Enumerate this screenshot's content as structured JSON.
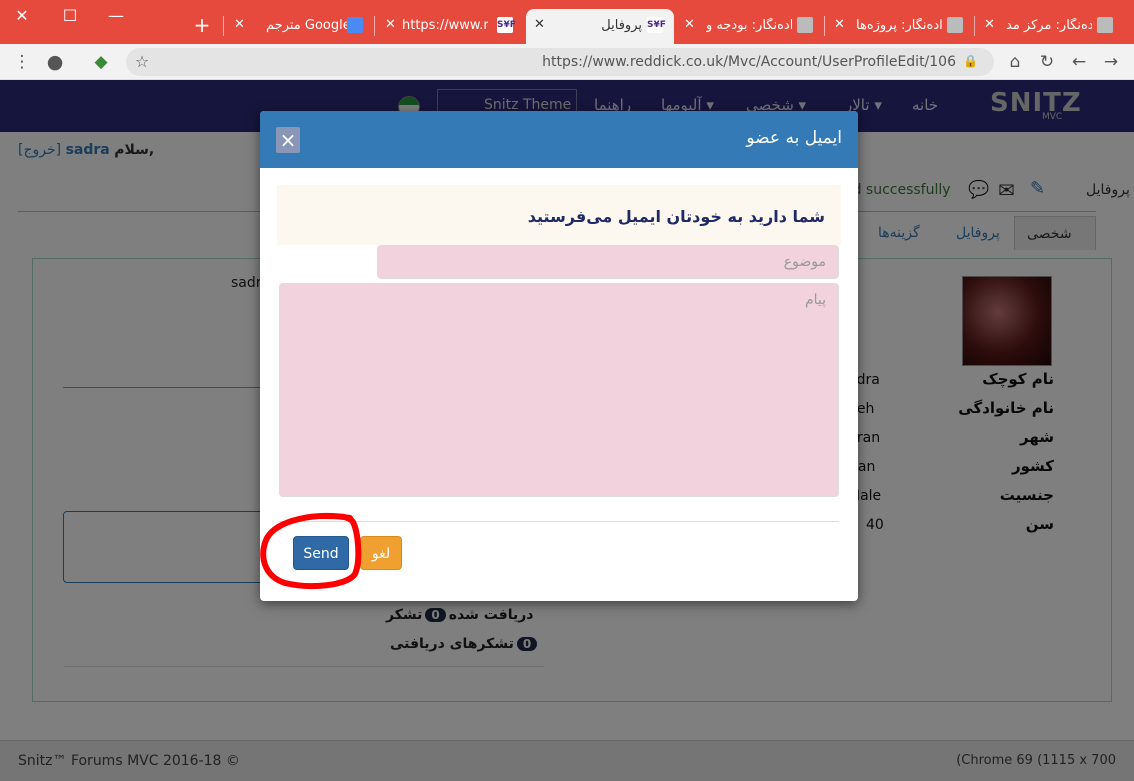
{
  "browser": {
    "window_controls": {
      "close": "✕",
      "maximize": "☐",
      "minimize": "—"
    },
    "new_tab": "+",
    "tabs": [
      {
        "label": "مترجم Google",
        "icon": "google-translate-icon"
      },
      {
        "label": "https://www.red",
        "icon": "snitz-icon"
      },
      {
        "label": "پروفایل",
        "icon": "snitz-icon",
        "active": true
      },
      {
        "label": "داده‌نگار: بودجه و",
        "icon": "cat-icon"
      },
      {
        "label": "داده‌نگار: پروژه‌ها",
        "icon": "cat-icon"
      },
      {
        "label": "داده‌نگار: مرکز مد",
        "icon": "cat-icon"
      }
    ],
    "tab_close": "✕",
    "url": "https://www.reddick.co.uk/Mvc/Account/UserProfileEdit/106"
  },
  "site": {
    "nav_items": [
      "خانه",
      "تالار ▾",
      "شخصی ▾",
      "آلبومها ▾",
      "راهنما"
    ],
    "theme_select": "Snitz Theme",
    "brand": "SNITZ",
    "brand_sub": "MVC",
    "greeting_user": "sadra",
    "greeting_hello": "سلام,",
    "greeting_logout": "[خروج]",
    "status_message": "lated successfully",
    "profile_link": "پروفایل",
    "profile_tabs": [
      "شخصی",
      "پروفایل",
      "گزینه‌ها"
    ],
    "left_username": "sadr",
    "fields": [
      {
        "label": "نام کوچک",
        "value": "adra"
      },
      {
        "label": "نام خانوادگی",
        "value": "deh"
      },
      {
        "label": "شهر",
        "value": "nran"
      },
      {
        "label": "کشور",
        "value": "Iran"
      },
      {
        "label": "جنسیت",
        "value": "Male"
      },
      {
        "label": "سن",
        "value": "40"
      }
    ],
    "stats": [
      {
        "label": "دریافت شده",
        "count": "0",
        "suffix": "تشکر"
      },
      {
        "label": "تشکرهای دریافتی",
        "count": "0"
      }
    ],
    "footer_left": "Snitz™ Forums MVC 2016-18 ©",
    "footer_right": "(Chrome 69 (1115 x 700"
  },
  "modal": {
    "title": "ایمیل به عضو",
    "close": "×",
    "warning": "شما دارید به خودتان ایمیل می‌فرستید",
    "subject_placeholder": "موضوع",
    "message_placeholder": "پیام",
    "send_label": "Send",
    "cancel_label": "لغو"
  },
  "colors": {
    "titlebar": "#e64a3d",
    "navbar": "#2d2b7a",
    "modal_header": "#337ab7",
    "send": "#2f6aa6",
    "cancel": "#f0a030",
    "highlight": "#ff0000"
  }
}
